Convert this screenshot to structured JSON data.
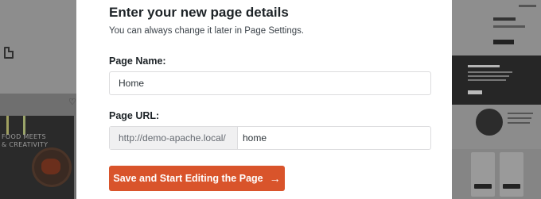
{
  "modal": {
    "title": "Enter your new page details",
    "subtitle": "You can always change it later in Page Settings.",
    "page_name_label": "Page Name:",
    "page_name_value": "Home",
    "page_url_label": "Page URL:",
    "url_prefix": "http://demo-apache.local/",
    "url_slug_value": "home",
    "submit_label": "Save and Start Editing the Page",
    "submit_arrow": "→"
  },
  "background": {
    "thumb_text_line1": "FOOD MEETS",
    "thumb_text_line2": "& CREATIVITY",
    "right_preview_heading": "Everyone.",
    "right_preview_dark_heading": "It's Never Been Easier"
  },
  "colors": {
    "accent": "#d9542b",
    "overlay": "#6f6f6f",
    "modal_bg": "#ffffff"
  },
  "icons": {
    "page": "document-icon",
    "favorite": "heart-icon",
    "submit": "arrow-right-icon"
  }
}
